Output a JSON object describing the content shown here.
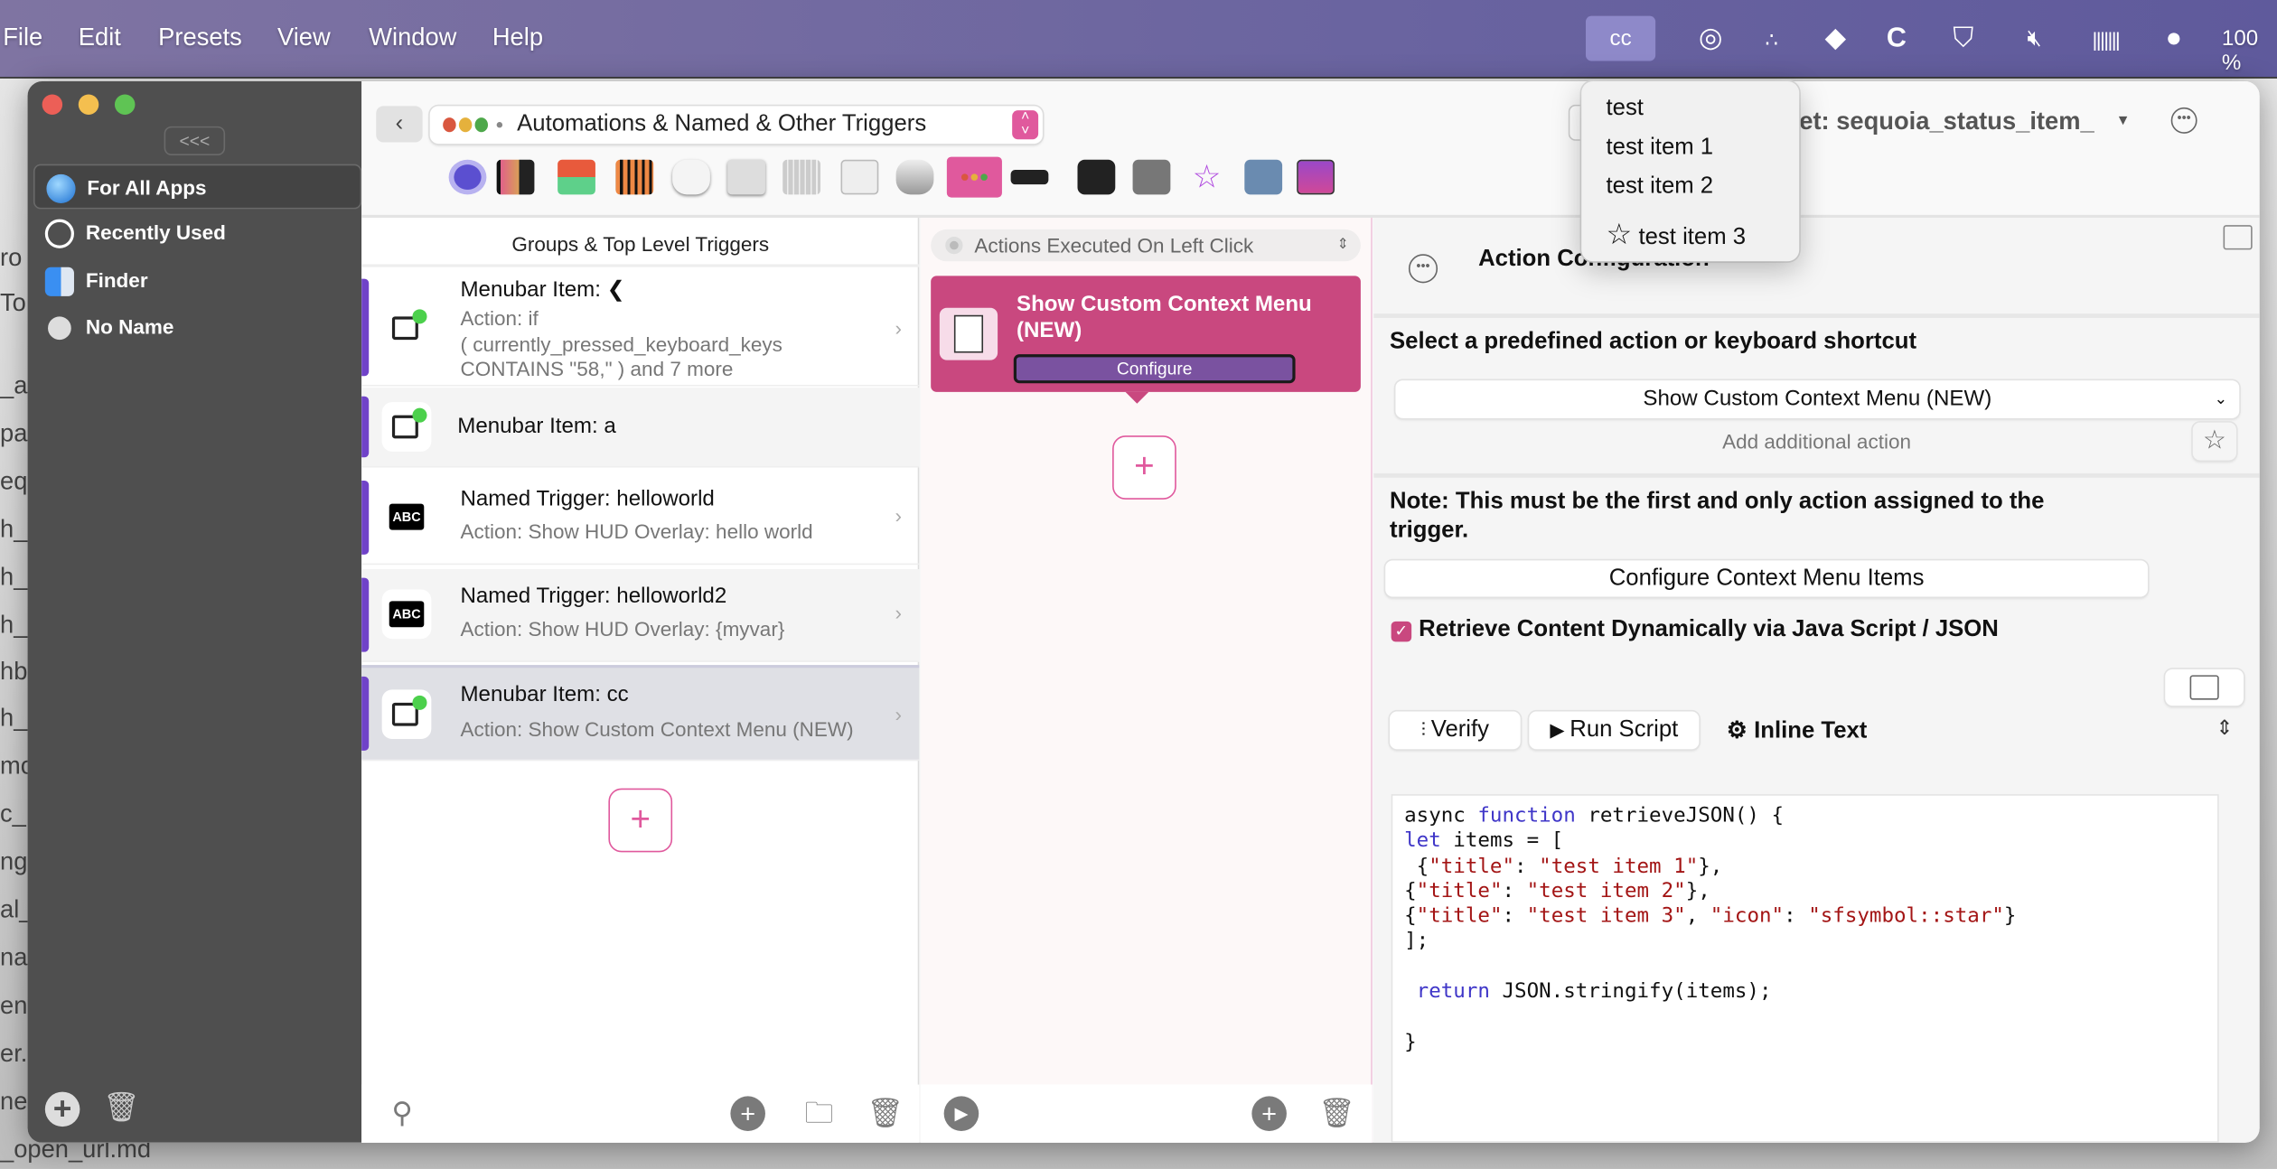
{
  "menubar": {
    "items": [
      "File",
      "Edit",
      "Presets",
      "View",
      "Window",
      "Help"
    ],
    "status_item_label": "cc",
    "battery": "100 %",
    "status_icons": [
      "fingerprint-lock-icon",
      "dots-icon",
      "layers-icon",
      "c-logo-icon",
      "shield-icon",
      "mute-icon",
      "equalizer-icon",
      "chat-bubble-icon"
    ]
  },
  "background_text": [
    "ro",
    "To",
    "_a",
    "pa",
    "eq",
    "h_",
    "h_",
    "h_",
    "hb",
    "h_",
    "mo",
    "c_",
    "ng",
    "al_",
    "nal",
    "en",
    "er.m",
    "ned",
    "_open_url.md"
  ],
  "sidebar": {
    "collapse_label": "<<<",
    "items": [
      {
        "label": "For All Apps",
        "icon": "globe-icon",
        "selected": true
      },
      {
        "label": "Recently Used",
        "icon": "clock-icon"
      },
      {
        "label": "Finder",
        "icon": "finder-icon"
      },
      {
        "label": "No Name",
        "icon": "circle-icon"
      }
    ]
  },
  "header": {
    "group_selector": "Automations & Named & Other Triggers",
    "behind_menu_text": "et: sequoia_status_item_",
    "toolbar_icons": [
      "touch-bar-icon",
      "macbook-touchbar-icon",
      "stream-deck-icon",
      "keypad-icon",
      "magic-mouse-icon",
      "trackpad-icon",
      "keyboard-icon",
      "gesture-keys-icon",
      "mouse-icon",
      "automations-icon",
      "siri-remote-icon",
      "notch-icon",
      "midi-icon",
      "drawings-icon",
      "remote-icon",
      "floating-menu-icon"
    ],
    "active_toolbar_index": 9
  },
  "triggers": {
    "header": "Groups & Top Level Triggers",
    "rows": [
      {
        "title": "Menubar Item: ❮",
        "subtitle": "Action: if\n( currently_pressed_keyboard_keys\nCONTAINS \"58,\" ) and 7 more",
        "icon": "menubar-item-icon"
      },
      {
        "title": "Menubar Item: a",
        "subtitle": "",
        "icon": "menubar-item-icon"
      },
      {
        "title": "Named Trigger: helloworld",
        "subtitle": "Action: Show HUD Overlay: hello world",
        "icon": "abc-icon"
      },
      {
        "title": "Named Trigger: helloworld2",
        "subtitle": "Action: Show HUD Overlay: {myvar}",
        "icon": "abc-icon"
      },
      {
        "title": "Menubar Item: cc",
        "subtitle": "Action: Show Custom Context Menu (NEW)",
        "icon": "menubar-item-icon",
        "selected": true
      }
    ],
    "abc_label": "ABC"
  },
  "actions": {
    "selector": "Actions Executed On Left Click",
    "card_title": "Show Custom Context Menu (NEW)",
    "configure_label": "Configure"
  },
  "config": {
    "title": "Action Configuration",
    "select_label": "Select a predefined action or keyboard shortcut",
    "selected_action": "Show Custom Context Menu (NEW)",
    "add_additional": "Add additional action",
    "note": "Note: This must be the first and only action assigned to the trigger.",
    "configure_items": "Configure Context Menu Items",
    "retrieve_label": "Retrieve Content Dynamically via Java Script / JSON",
    "retrieve_checked": true,
    "verify": "Verify",
    "run_script": "Run Script",
    "inline_text": "Inline Text",
    "code": [
      [
        [
          "",
          "async "
        ],
        [
          "kw",
          "function"
        ],
        [
          "",
          " retrieveJSON() {"
        ]
      ],
      [
        [
          "kw",
          "let"
        ],
        [
          "",
          " items = ["
        ]
      ],
      [
        [
          "",
          " {"
        ],
        [
          "str",
          "\"title\""
        ],
        [
          "",
          ": "
        ],
        [
          "str",
          "\"test item 1\""
        ],
        [
          "",
          "},"
        ]
      ],
      [
        [
          "",
          "{"
        ],
        [
          "str",
          "\"title\""
        ],
        [
          "",
          ": "
        ],
        [
          "str",
          "\"test item 2\""
        ],
        [
          "",
          "},"
        ]
      ],
      [
        [
          "",
          "{"
        ],
        [
          "str",
          "\"title\""
        ],
        [
          "",
          ": "
        ],
        [
          "str",
          "\"test item 3\""
        ],
        [
          "",
          ", "
        ],
        [
          "str",
          "\"icon\""
        ],
        [
          "",
          ": "
        ],
        [
          "str",
          "\"sfsymbol::star\""
        ],
        [
          "",
          "}"
        ]
      ],
      [
        [
          "",
          "];"
        ]
      ],
      [
        [
          "",
          ""
        ]
      ],
      [
        [
          "",
          " "
        ],
        [
          "kw",
          "return"
        ],
        [
          "",
          " JSON.stringify(items);"
        ]
      ],
      [
        [
          "",
          ""
        ]
      ],
      [
        [
          "",
          "}"
        ]
      ]
    ]
  },
  "context_menu": {
    "items": [
      {
        "label": "test"
      },
      {
        "label": "test item 1"
      },
      {
        "label": "test item 2"
      },
      {
        "label": "test item 3",
        "icon": "star-icon"
      }
    ]
  },
  "colors": {
    "accent": "#e0599d",
    "card": "#c9487f",
    "configure": "#7a52a0",
    "trigger_bar": "#7043c8",
    "menubar": "#6a64a0"
  }
}
